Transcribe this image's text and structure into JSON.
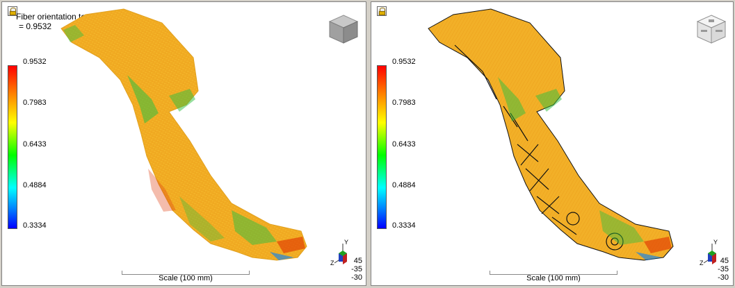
{
  "left_pane": {
    "title_line1": "Fiber orientation tensor",
    "title_line2": "= 0.9532",
    "legend_ticks": [
      "0.9532",
      "0.7983",
      "0.6433",
      "0.4884",
      "0.3334"
    ],
    "scale_label": "Scale (100 mm)",
    "axis_y_label": "Y",
    "axis_z_label": "Z",
    "angles": [
      "45",
      "-35",
      "-30"
    ],
    "view_cube_icon": "view-cube-solid"
  },
  "right_pane": {
    "legend_ticks": [
      "0.9532",
      "0.7983",
      "0.6433",
      "0.4884",
      "0.3334"
    ],
    "scale_label": "Scale (100 mm)",
    "axis_y_label": "Y",
    "axis_z_label": "Z",
    "angles": [
      "45",
      "-35",
      "-30"
    ],
    "view_cube_icon": "view-cube-labeled"
  },
  "colors": {
    "part_main": "#f0a020",
    "part_light": "#f8c030",
    "part_hot": "#e03000",
    "part_green": "#30c040",
    "part_blue": "#0080ff"
  }
}
